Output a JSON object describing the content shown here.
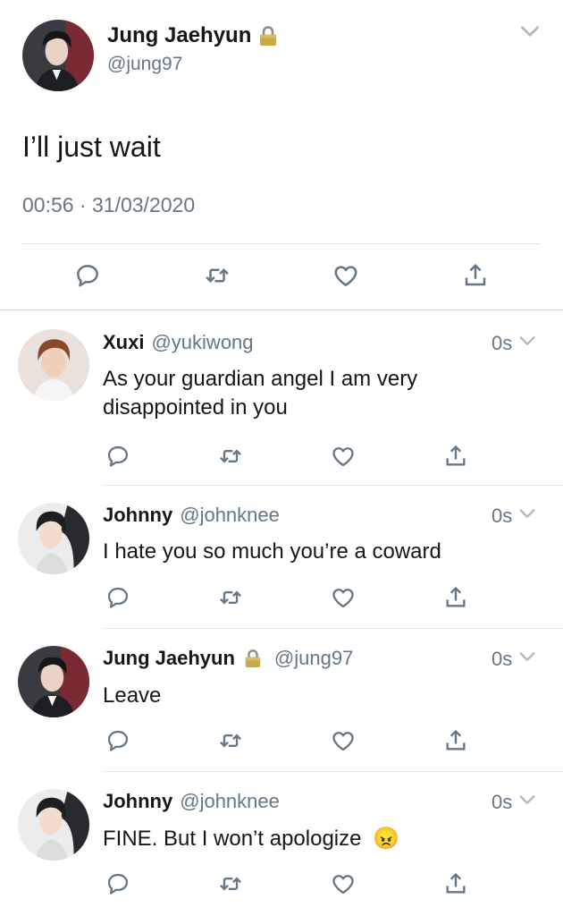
{
  "main_tweet": {
    "name": "Jung Jaehyun",
    "handle": "@jung97",
    "text": "I’ll just wait",
    "timestamp": "00:56 · 31/03/2020",
    "locked": true
  },
  "replies": [
    {
      "name": "Xuxi",
      "handle": "@yukiwong",
      "time": "0s",
      "text": "As your guardian angel I am very disappointed in you",
      "locked": false
    },
    {
      "name": "Johnny",
      "handle": "@johnknee",
      "time": "0s",
      "text": "I hate you so much you’re a coward",
      "locked": false
    },
    {
      "name": "Jung Jaehyun",
      "handle": "@jung97",
      "time": "0s",
      "text": "Leave",
      "locked": true
    },
    {
      "name": "Johnny",
      "handle": "@johnknee",
      "time": "0s",
      "text": "FINE. But I won’t apologize",
      "emoji": "😠",
      "locked": false
    }
  ],
  "colors": {
    "icon": "#657786",
    "divider": "#e1e8ed",
    "text": "#14171a"
  },
  "icons": [
    "reply-icon",
    "retweet-icon",
    "like-icon",
    "share-icon",
    "chevron-down-icon",
    "lock-icon"
  ]
}
